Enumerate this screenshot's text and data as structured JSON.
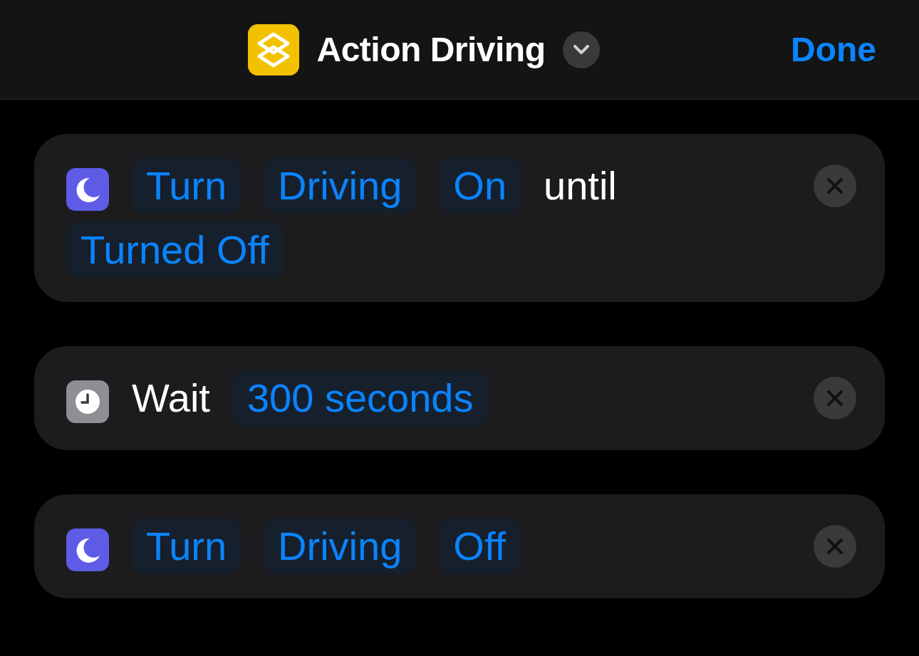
{
  "header": {
    "title": "Action Driving",
    "done": "Done"
  },
  "actions": [
    {
      "kind": "focus",
      "parts": [
        {
          "kind": "token",
          "text": "Turn"
        },
        {
          "kind": "token",
          "text": "Driving"
        },
        {
          "kind": "token",
          "text": "On"
        },
        {
          "kind": "text",
          "text": "until"
        },
        {
          "kind": "token",
          "text": "Turned Off"
        }
      ]
    },
    {
      "kind": "clock",
      "parts": [
        {
          "kind": "text",
          "text": "Wait"
        },
        {
          "kind": "token",
          "text": "300 seconds"
        }
      ]
    },
    {
      "kind": "focus",
      "parts": [
        {
          "kind": "token",
          "text": "Turn"
        },
        {
          "kind": "token",
          "text": "Driving"
        },
        {
          "kind": "token",
          "text": "Off"
        }
      ]
    }
  ]
}
